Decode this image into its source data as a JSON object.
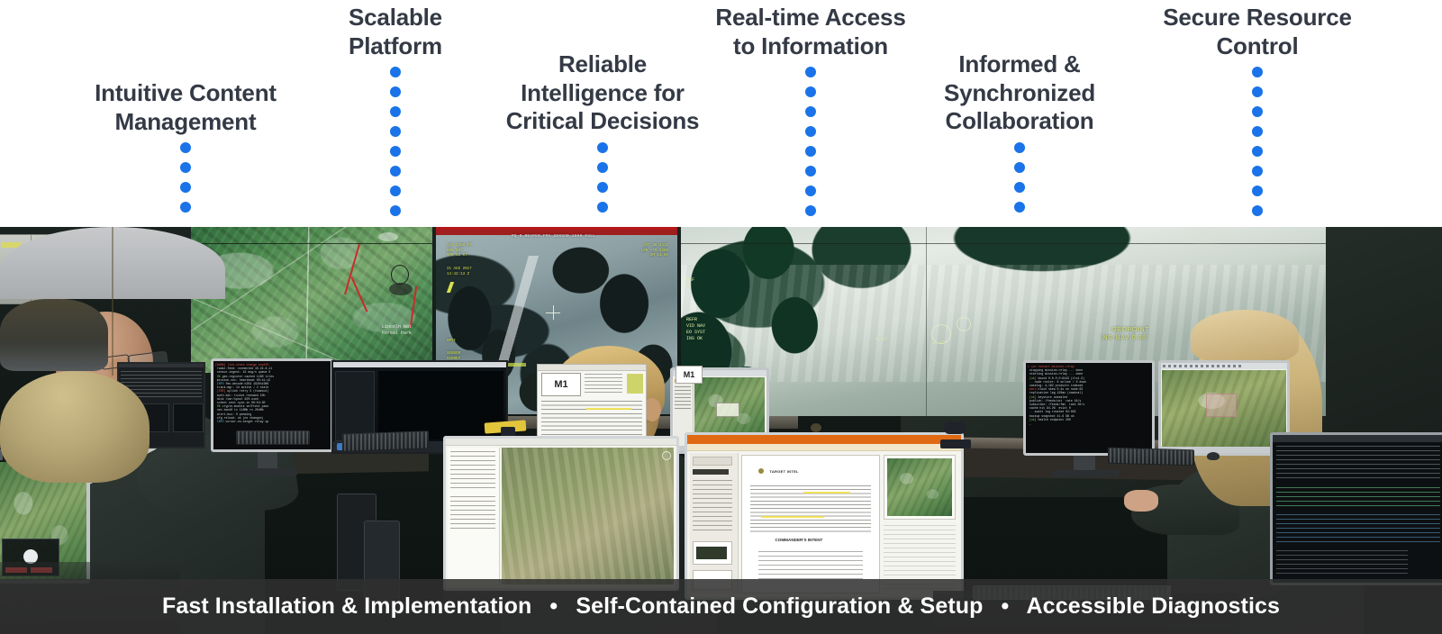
{
  "callouts": [
    {
      "label": "Intuitive Content\nManagement",
      "dots": 4,
      "accent": "#1a73e8"
    },
    {
      "label": "Scalable\nPlatform",
      "dots": 8,
      "accent": "#1a73e8"
    },
    {
      "label": "Reliable\nIntelligence for\nCritical Decisions",
      "dots": 4,
      "accent": "#1a73e8"
    },
    {
      "label": "Real-time Access\nto Information",
      "dots": 8,
      "accent": "#1a73e8"
    },
    {
      "label": "Informed &\nSynchronized\nCollaboration",
      "dots": 4,
      "accent": "#1a73e8"
    },
    {
      "label": "Secure Resource\nControl",
      "dots": 8,
      "accent": "#1a73e8"
    }
  ],
  "caption": {
    "items": [
      "Fast Installation & Implementation",
      "Self-Contained Configuration & Setup",
      "Accessible Diagnostics"
    ],
    "separator": "•",
    "background": "#303030",
    "text_color": "#ffffff"
  },
  "photo": {
    "description": "Command and control operations center with four operators at workstations facing a large video wall",
    "videowall": {
      "screen_map_label": "",
      "screen_geo_line1": "GEOPOINT",
      "screen_geo_line2": "INS-NAV 0.08°",
      "screen_ir_banner": "",
      "screen_ir_osd_left": "ALT 1250 FT\nHDG 287\nSPD 42 KT",
      "screen_ir_osd_right": "LAT 38.4412\nLON -79.2280\nZM 12.0X"
    },
    "desktop": {
      "popup_label": "M1",
      "document_title": "TARGET INTEL",
      "document_subhead": "COMMANDER'S INTENT"
    }
  },
  "theme": {
    "heading_color": "#343a45",
    "dot_color": "#1a73e8",
    "page_background": "#ffffff"
  }
}
